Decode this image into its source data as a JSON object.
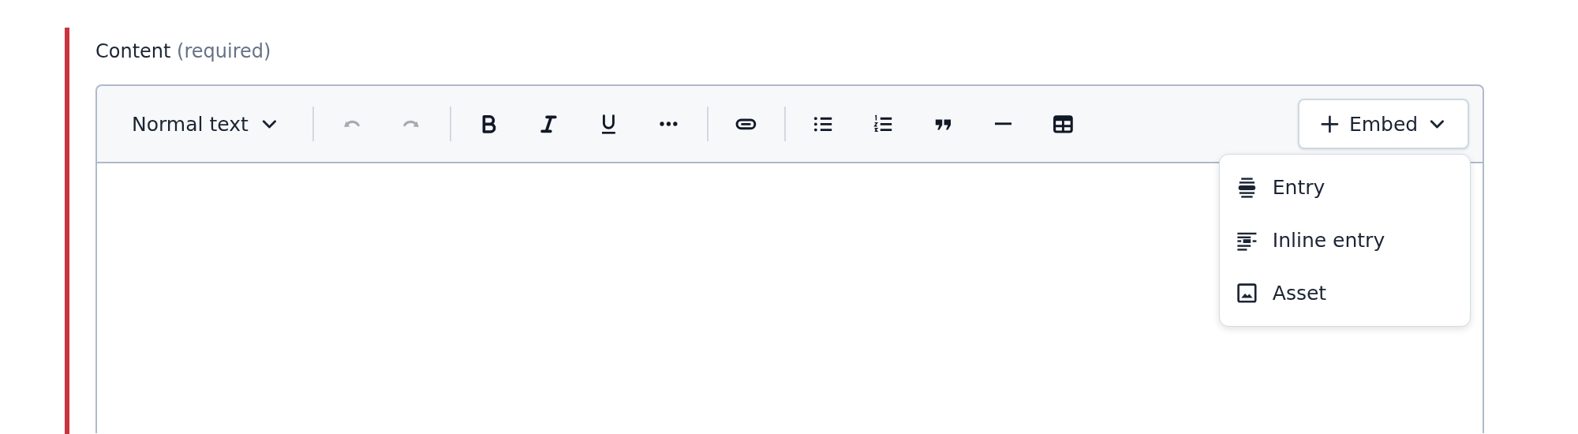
{
  "field": {
    "label": "Content",
    "hint": "(required)",
    "invalid": true
  },
  "toolbar": {
    "items": [
      {
        "kind": "select",
        "label": "Normal text"
      },
      {
        "kind": "separator"
      },
      {
        "kind": "button",
        "disabled": true
      },
      {
        "kind": "button",
        "disabled": true
      },
      {
        "kind": "separator"
      },
      {
        "kind": "button",
        "disabled": false
      },
      {
        "kind": "button",
        "disabled": false
      },
      {
        "kind": "button",
        "disabled": false
      },
      {
        "kind": "button",
        "disabled": false
      },
      {
        "kind": "separator"
      },
      {
        "kind": "button",
        "disabled": false
      },
      {
        "kind": "separator"
      },
      {
        "kind": "button",
        "disabled": false
      },
      {
        "kind": "button",
        "disabled": false
      },
      {
        "kind": "button",
        "disabled": false
      },
      {
        "kind": "button",
        "disabled": false
      },
      {
        "kind": "button",
        "disabled": false
      }
    ]
  },
  "embed": {
    "label": "Embed",
    "expanded": true,
    "menu": [
      {
        "label": "Entry"
      },
      {
        "label": "Inline entry"
      },
      {
        "label": "Asset"
      }
    ]
  }
}
